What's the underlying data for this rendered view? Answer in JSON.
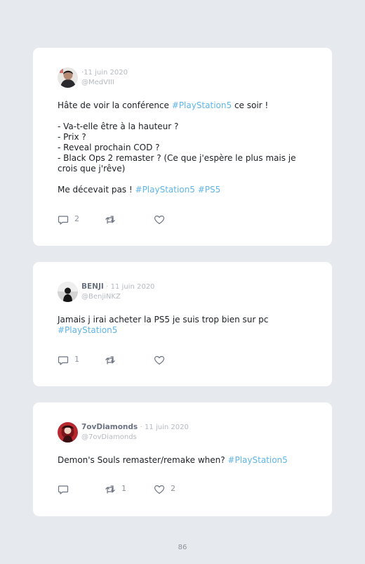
{
  "tweets": [
    {
      "name": "",
      "date": "11 juin 2020",
      "handle": "@MedVIII",
      "lines": [
        [
          {
            "t": "Hâte de voir la conférence "
          },
          {
            "t": "#PlayStation5",
            "tag": true
          },
          {
            "t": " ce soir !"
          }
        ],
        [],
        [
          {
            "t": "- Va-t-elle être à la hauteur ?"
          }
        ],
        [
          {
            "t": "- Prix ?"
          }
        ],
        [
          {
            "t": "- Reveal prochain COD ?"
          }
        ],
        [
          {
            "t": "- Black Ops 2 remaster ? (Ce que j'espère le plus mais je"
          }
        ],
        [
          {
            "t": "crois que j'rêve)"
          }
        ],
        [],
        [
          {
            "t": "Me décevait pas ! "
          },
          {
            "t": "#PlayStation5",
            "tag": true
          },
          {
            "t": " "
          },
          {
            "t": "#PS5",
            "tag": true
          }
        ]
      ],
      "replies": "2",
      "retweets": "",
      "likes": ""
    },
    {
      "name": "BENJI",
      "date": "11 juin 2020",
      "handle": "@BenjiNKZ",
      "lines": [
        [
          {
            "t": "Jamais j irai acheter la PS5 je suis trop bien sur pc"
          }
        ],
        [
          {
            "t": "#PlayStation5",
            "tag": true
          }
        ]
      ],
      "replies": "1",
      "retweets": "",
      "likes": ""
    },
    {
      "name": "7ovDiamonds",
      "date": "11 juin 2020",
      "handle": "@7ovDiamonds",
      "lines": [
        [
          {
            "t": "Demon's Souls remaster/remake when? "
          },
          {
            "t": "#PlayStation5",
            "tag": true
          }
        ]
      ],
      "replies": "",
      "retweets": "1",
      "likes": "2"
    }
  ],
  "page_number": "86",
  "colors": {
    "background": "#e6e9ee",
    "card": "#ffffff",
    "hashtag": "#5fb5e8",
    "muted": "#b4bac2",
    "icon": "#6b7280"
  },
  "icons": {
    "reply": "comment-icon",
    "retweet": "retweet-icon",
    "like": "heart-icon"
  }
}
